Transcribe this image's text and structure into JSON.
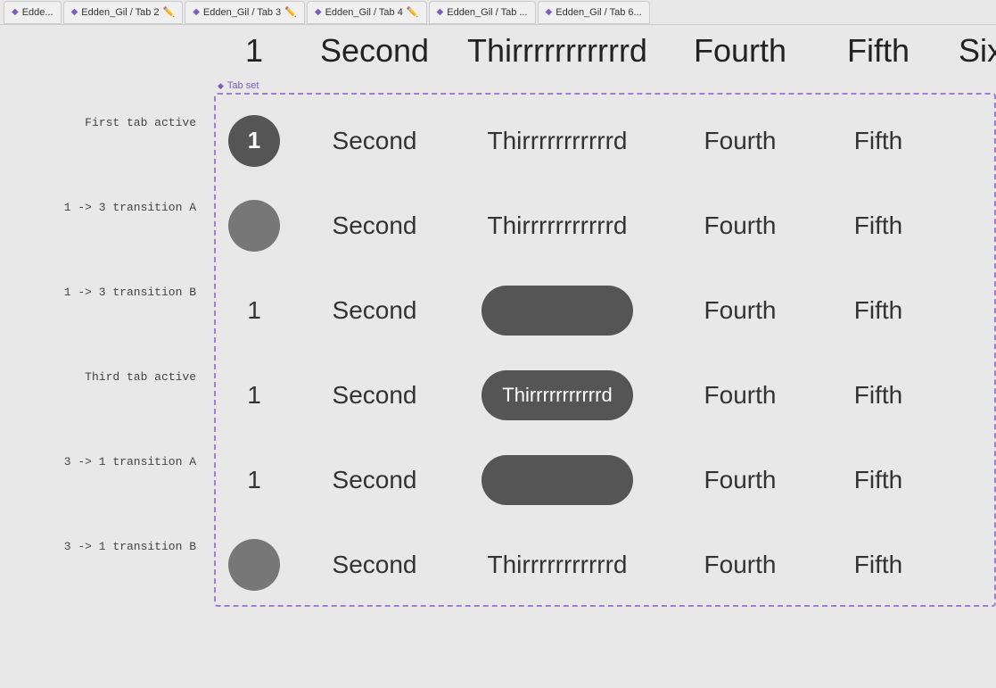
{
  "tabbar": {
    "tabs": [
      {
        "label": "Edde...",
        "suffix": ""
      },
      {
        "label": "Edden_Gil / Tab 2",
        "suffix": "✏️"
      },
      {
        "label": "Edden_Gil / Tab 3",
        "suffix": "✏️"
      },
      {
        "label": "Edden_Gil / Tab 4",
        "suffix": "✏️"
      },
      {
        "label": "Edden_Gil / Tab ...",
        "suffix": ""
      },
      {
        "label": "Edden_Gil / Tab 6...",
        "suffix": ""
      }
    ]
  },
  "heading": {
    "col1": "1",
    "col2": "Second",
    "col3": "Thirrrrrrrrrrrd",
    "col4": "Fourth",
    "col5": "Fifth",
    "col6": "Sixth"
  },
  "tabset_label": "Tab set",
  "rows": [
    {
      "label": "First tab active",
      "tab1": {
        "type": "circle-active",
        "text": "1"
      },
      "tab2": {
        "type": "text",
        "text": "Second"
      },
      "tab3": {
        "type": "text",
        "text": "Thirrrrrrrrrrrd"
      },
      "tab4": {
        "type": "text",
        "text": "Fourth"
      },
      "tab5": {
        "type": "text",
        "text": "Fifth"
      }
    },
    {
      "label": "1 -> 3 transition A",
      "tab1": {
        "type": "circle-inactive"
      },
      "tab2": {
        "type": "text",
        "text": "Second"
      },
      "tab3": {
        "type": "text",
        "text": "Thirrrrrrrrrrrd"
      },
      "tab4": {
        "type": "text",
        "text": "Fourth"
      },
      "tab5": {
        "type": "text",
        "text": "Fifth"
      }
    },
    {
      "label": "1 -> 3 transition B",
      "tab1": {
        "type": "number",
        "text": "1"
      },
      "tab2": {
        "type": "text",
        "text": "Second"
      },
      "tab3": {
        "type": "pill-empty"
      },
      "tab4": {
        "type": "text",
        "text": "Fourth"
      },
      "tab5": {
        "type": "text",
        "text": "Fifth"
      }
    },
    {
      "label": "Third tab active",
      "tab1": {
        "type": "number",
        "text": "1"
      },
      "tab2": {
        "type": "text",
        "text": "Second"
      },
      "tab3": {
        "type": "pill-active",
        "text": "Thirrrrrrrrrrrd"
      },
      "tab4": {
        "type": "text",
        "text": "Fourth"
      },
      "tab5": {
        "type": "text",
        "text": "Fifth"
      }
    },
    {
      "label": "3 -> 1 transition A",
      "tab1": {
        "type": "number",
        "text": "1"
      },
      "tab2": {
        "type": "text",
        "text": "Second"
      },
      "tab3": {
        "type": "pill-empty"
      },
      "tab4": {
        "type": "text",
        "text": "Fourth"
      },
      "tab5": {
        "type": "text",
        "text": "Fifth"
      }
    },
    {
      "label": "3 -> 1 transition B",
      "tab1": {
        "type": "circle-inactive"
      },
      "tab2": {
        "type": "text",
        "text": "Second"
      },
      "tab3": {
        "type": "text",
        "text": "Thirrrrrrrrrrrd"
      },
      "tab4": {
        "type": "text",
        "text": "Fourth"
      },
      "tab5": {
        "type": "text",
        "text": "Fifth"
      }
    }
  ]
}
